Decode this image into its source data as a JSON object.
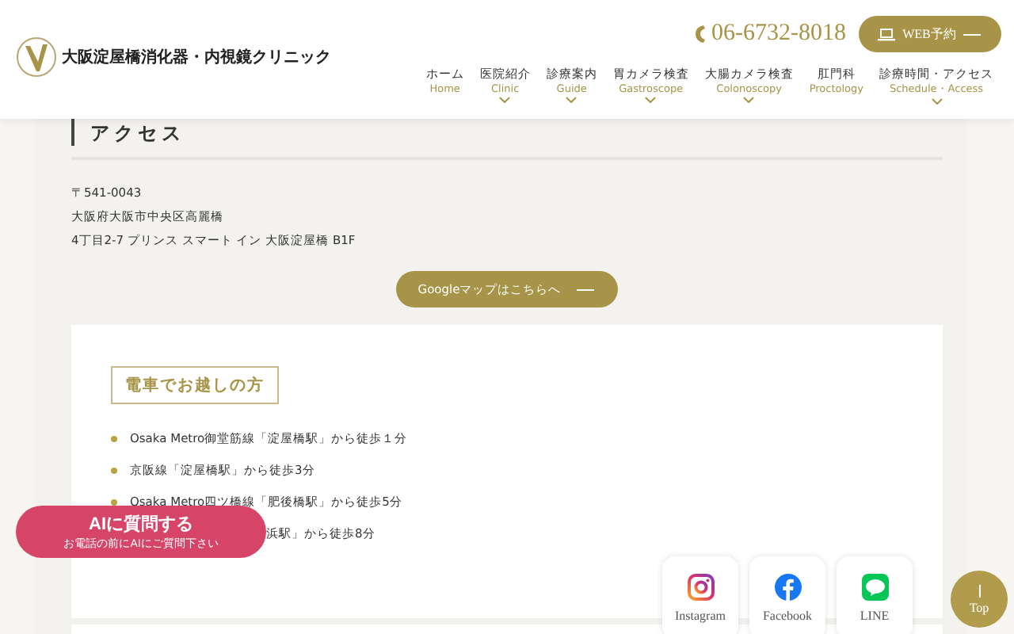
{
  "header": {
    "logo_title": "大阪淀屋橋消化器・内視鏡クリニック",
    "phone": "06-6732-8018",
    "web_button": "WEB予約",
    "nav": [
      {
        "ja": "ホーム",
        "en": "Home",
        "dropdown": false
      },
      {
        "ja": "医院紹介",
        "en": "Clinic",
        "dropdown": true
      },
      {
        "ja": "診療案内",
        "en": "Guide",
        "dropdown": true
      },
      {
        "ja": "胃カメラ検査",
        "en": "Gastroscope",
        "dropdown": true
      },
      {
        "ja": "大腸カメラ検査",
        "en": "Colonoscopy",
        "dropdown": true
      },
      {
        "ja": "肛門科",
        "en": "Proctology",
        "dropdown": false
      },
      {
        "ja": "診療時間・アクセス",
        "en": "Schedule・Access",
        "dropdown": true
      }
    ]
  },
  "section_title": "アクセス",
  "address": [
    "〒541-0043",
    "大阪府大阪市中央区高麗橋",
    "4丁目2-7 プリンス スマート イン 大阪淀屋橋 B1F"
  ],
  "map_button": "Googleマップはこちらへ",
  "train": {
    "title": "電車でお越しの方",
    "items": [
      "Osaka Metro御堂筋線「淀屋橋駅」から徒歩１分",
      "京阪線「淀屋橋駅」から徒歩3分",
      "Osaka Metro四ツ橋線「肥後橋駅」から徒歩5分",
      "浜駅」から徒歩8分"
    ]
  },
  "ai_button": {
    "title": "AIに質問する",
    "subtitle": "お電話の前にAIにご質問下さい"
  },
  "social": [
    {
      "kind": "instagram",
      "label": "Instagram"
    },
    {
      "kind": "facebook",
      "label": "Facebook"
    },
    {
      "kind": "line",
      "label": "LINE"
    }
  ],
  "top_button": "Top"
}
